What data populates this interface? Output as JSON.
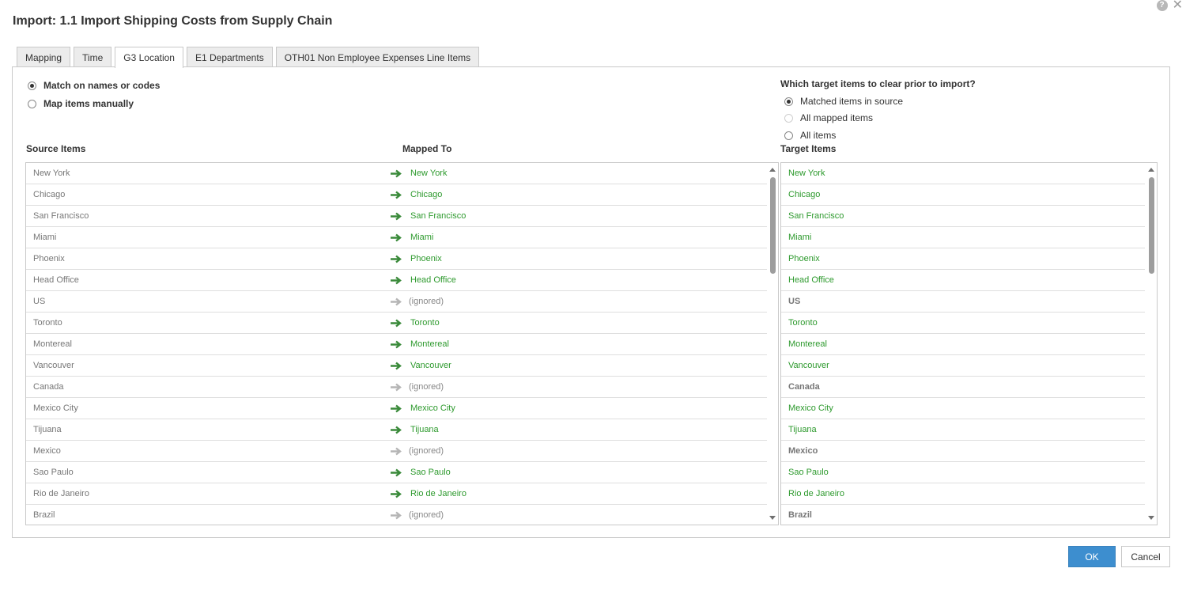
{
  "dialog": {
    "title": "Import: 1.1 Import Shipping Costs from Supply Chain",
    "help_symbol": "?",
    "close_symbol": "✕"
  },
  "tabs": [
    {
      "label": "Mapping",
      "active": false
    },
    {
      "label": "Time",
      "active": false
    },
    {
      "label": "G3 Location",
      "active": true
    },
    {
      "label": "E1 Departments",
      "active": false
    },
    {
      "label": "OTH01 Non Employee Expenses Line Items",
      "active": false
    }
  ],
  "match_options": {
    "names_or_codes": {
      "label": "Match on names or codes",
      "checked": true
    },
    "manual": {
      "label": "Map items manually",
      "checked": false
    }
  },
  "clear_options": {
    "heading": "Which target items to clear prior to import?",
    "matched": {
      "label": "Matched items in source",
      "checked": true
    },
    "all_mapped": {
      "label": "All mapped items",
      "checked": false,
      "disabled": true
    },
    "all": {
      "label": "All items",
      "checked": false
    }
  },
  "columns": {
    "source": "Source Items",
    "mapped": "Mapped To",
    "target": "Target Items"
  },
  "mapping_rows": [
    {
      "source": "New York",
      "mapped": "New York",
      "ignored": false
    },
    {
      "source": "Chicago",
      "mapped": "Chicago",
      "ignored": false
    },
    {
      "source": "San Francisco",
      "mapped": "San Francisco",
      "ignored": false
    },
    {
      "source": "Miami",
      "mapped": "Miami",
      "ignored": false
    },
    {
      "source": "Phoenix",
      "mapped": "Phoenix",
      "ignored": false
    },
    {
      "source": "Head Office",
      "mapped": "Head Office",
      "ignored": false
    },
    {
      "source": "US",
      "mapped": "(ignored)",
      "ignored": true
    },
    {
      "source": "Toronto",
      "mapped": "Toronto",
      "ignored": false
    },
    {
      "source": "Montereal",
      "mapped": "Montereal",
      "ignored": false
    },
    {
      "source": "Vancouver",
      "mapped": "Vancouver",
      "ignored": false
    },
    {
      "source": "Canada",
      "mapped": "(ignored)",
      "ignored": true
    },
    {
      "source": "Mexico City",
      "mapped": "Mexico City",
      "ignored": false
    },
    {
      "source": "Tijuana",
      "mapped": "Tijuana",
      "ignored": false
    },
    {
      "source": "Mexico",
      "mapped": "(ignored)",
      "ignored": true
    },
    {
      "source": "Sao Paulo",
      "mapped": "Sao Paulo",
      "ignored": false
    },
    {
      "source": "Rio de Janeiro",
      "mapped": "Rio de Janeiro",
      "ignored": false
    },
    {
      "source": "Brazil",
      "mapped": "(ignored)",
      "ignored": true
    }
  ],
  "target_rows": [
    {
      "label": "New York",
      "matched": true
    },
    {
      "label": "Chicago",
      "matched": true
    },
    {
      "label": "San Francisco",
      "matched": true
    },
    {
      "label": "Miami",
      "matched": true
    },
    {
      "label": "Phoenix",
      "matched": true
    },
    {
      "label": "Head Office",
      "matched": true
    },
    {
      "label": "US",
      "matched": false
    },
    {
      "label": "Toronto",
      "matched": true
    },
    {
      "label": "Montereal",
      "matched": true
    },
    {
      "label": "Vancouver",
      "matched": true
    },
    {
      "label": "Canada",
      "matched": false
    },
    {
      "label": "Mexico City",
      "matched": true
    },
    {
      "label": "Tijuana",
      "matched": true
    },
    {
      "label": "Mexico",
      "matched": false
    },
    {
      "label": "Sao Paulo",
      "matched": true
    },
    {
      "label": "Rio de Janeiro",
      "matched": true
    },
    {
      "label": "Brazil",
      "matched": false
    }
  ],
  "buttons": {
    "ok": "OK",
    "cancel": "Cancel"
  },
  "colors": {
    "mapped_green": "#2e9a2e",
    "arrow_green": "#3a8a3a",
    "arrow_gray": "#b5b5b5",
    "ok_blue": "#3d8ecf"
  }
}
